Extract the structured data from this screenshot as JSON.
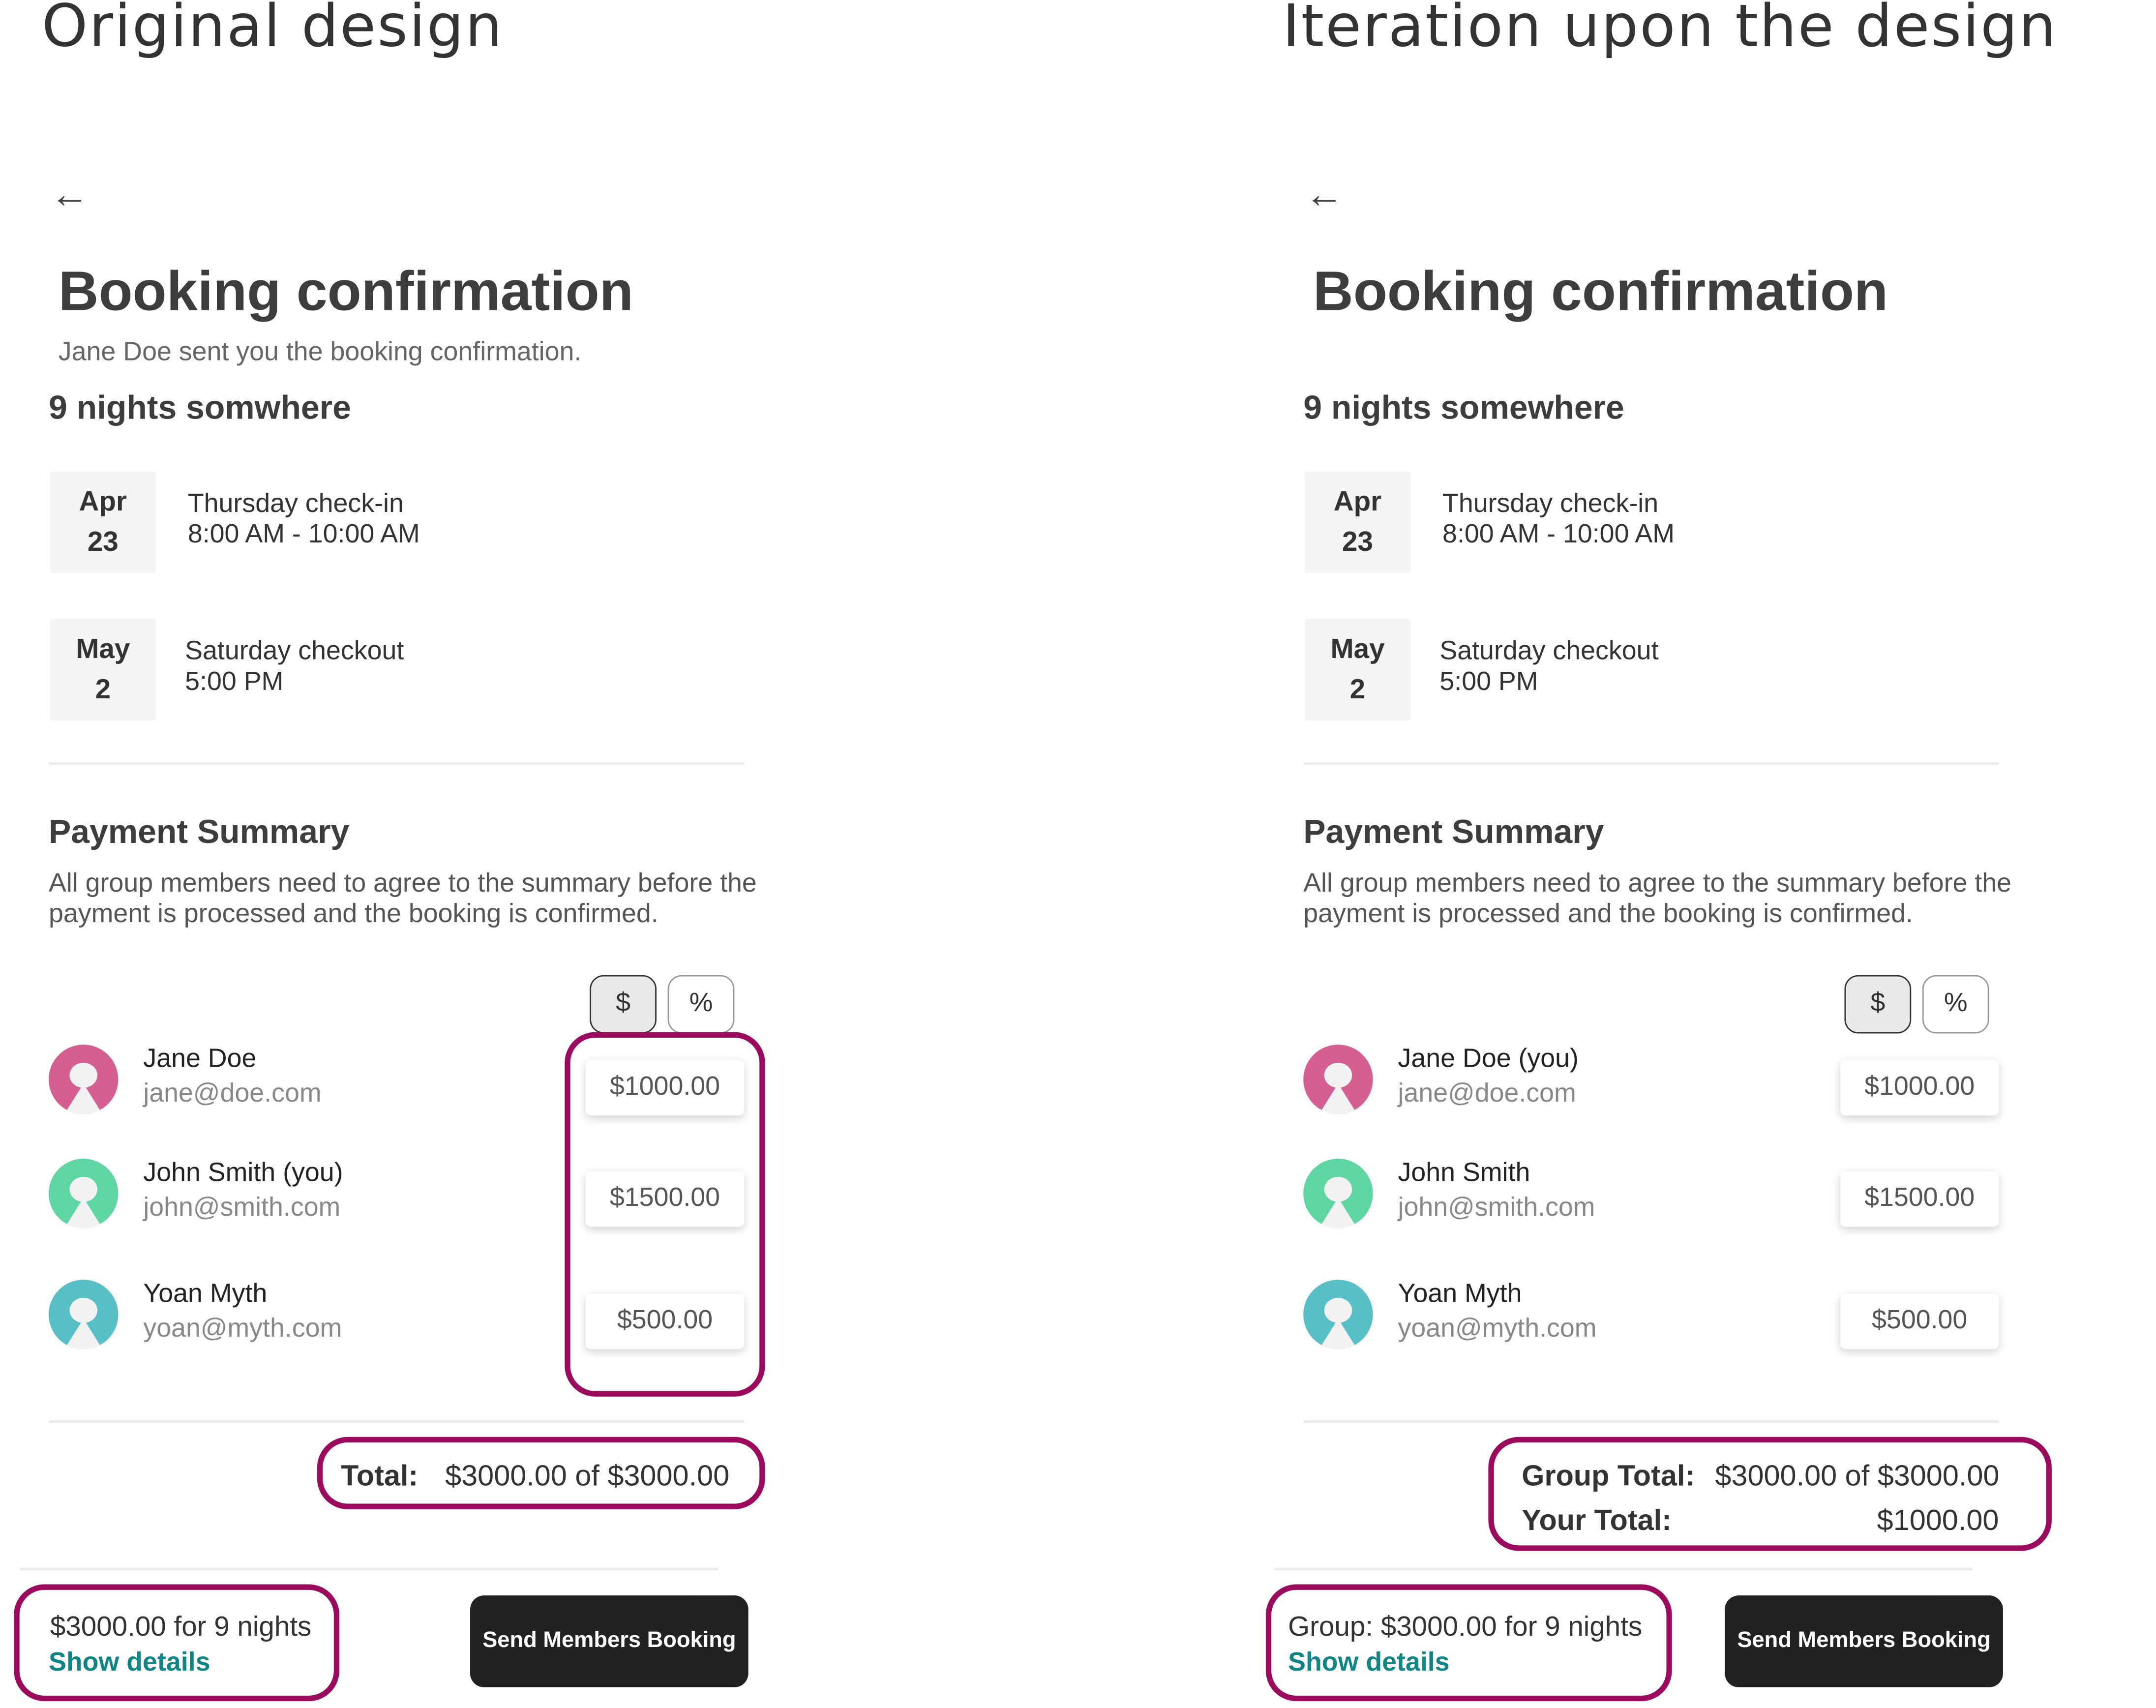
{
  "colors": {
    "highlight": "#9c0a5e",
    "link": "#0f8585",
    "button": "#222222",
    "avatar_jane": "#d65f92",
    "avatar_john": "#5dd6a2",
    "avatar_yoan": "#57bfc6"
  },
  "panels": [
    {
      "heading": "Original design",
      "back_icon": "arrow-left-icon",
      "title": "Booking confirmation",
      "subtitle": "Jane Doe sent you the booking confirmation.",
      "trip": "9 nights somwhere",
      "checkin": {
        "month": "Apr",
        "day": "23",
        "label": "Thursday check-in",
        "time": "8:00 AM - 10:00 AM"
      },
      "checkout": {
        "month": "May",
        "day": "2",
        "label": "Saturday checkout",
        "time": "5:00 PM"
      },
      "payment_title": "Payment Summary",
      "payment_desc": "All group members need to agree to the summary before the payment is processed and the booking is confirmed.",
      "toggle": {
        "dollar": "$",
        "percent": "%",
        "selected": "$"
      },
      "members": [
        {
          "name": "Jane Doe",
          "email": "jane@doe.com",
          "amount": "$1000.00"
        },
        {
          "name": "John Smith (you)",
          "email": "john@smith.com",
          "amount": "$1500.00"
        },
        {
          "name": "Yoan Myth",
          "email": "yoan@myth.com",
          "amount": "$500.00"
        }
      ],
      "total_label": "Total:",
      "total_value": "$3000.00 of $3000.00",
      "footer_price": "$3000.00 for 9 nights",
      "show_details": "Show details",
      "send_button": "Send Members Booking"
    },
    {
      "heading": "Iteration upon the design",
      "back_icon": "arrow-left-icon",
      "title": "Booking confirmation",
      "trip": "9 nights somewhere",
      "checkin": {
        "month": "Apr",
        "day": "23",
        "label": "Thursday check-in",
        "time": "8:00 AM - 10:00 AM"
      },
      "checkout": {
        "month": "May",
        "day": "2",
        "label": "Saturday checkout",
        "time": "5:00 PM"
      },
      "payment_title": "Payment Summary",
      "payment_desc": "All group members need to agree to the summary before the payment is processed and the booking is confirmed.",
      "toggle": {
        "dollar": "$",
        "percent": "%",
        "selected": "$"
      },
      "members": [
        {
          "name": "Jane Doe (you)",
          "email": "jane@doe.com",
          "amount": "$1000.00"
        },
        {
          "name": "John Smith",
          "email": "john@smith.com",
          "amount": "$1500.00"
        },
        {
          "name": "Yoan Myth",
          "email": "yoan@myth.com",
          "amount": "$500.00"
        }
      ],
      "group_total_label": "Group Total:",
      "group_total_value": "$3000.00 of $3000.00",
      "your_total_label": "Your Total:",
      "your_total_value": "$1000.00",
      "footer_price": "Group: $3000.00 for 9 nights",
      "show_details": "Show details",
      "send_button": "Send Members Booking"
    }
  ]
}
